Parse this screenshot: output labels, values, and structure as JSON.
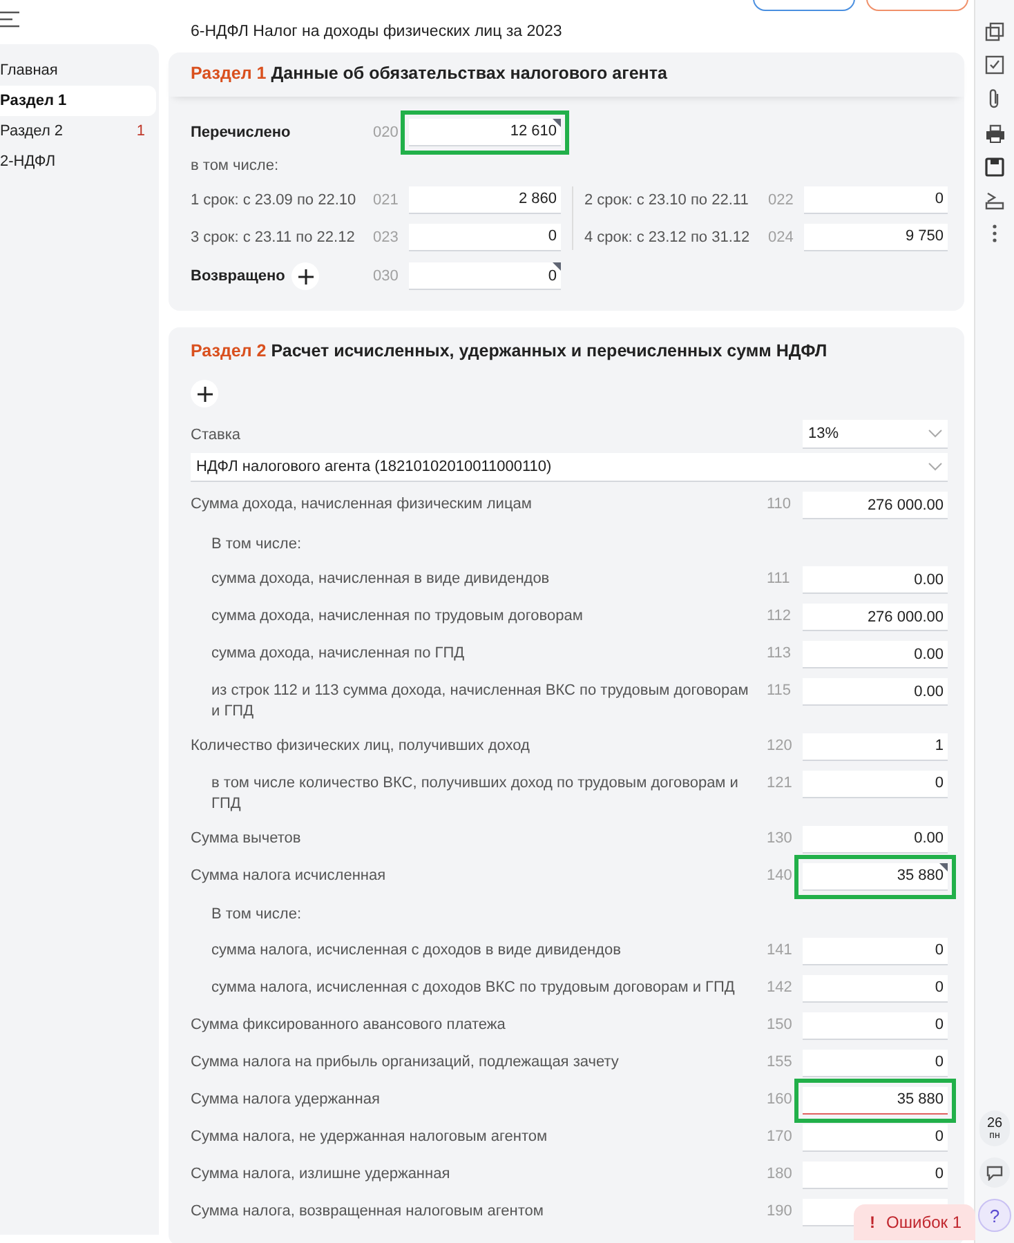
{
  "header": {
    "title": "6-НДФЛ Налог на доходы физических лиц за 2023"
  },
  "sidebar": {
    "items": [
      {
        "label": "Главная",
        "selected": false
      },
      {
        "label": "Раздел 1",
        "selected": true
      },
      {
        "label": "Раздел 2",
        "selected": false,
        "badge": "1"
      },
      {
        "label": "2-НДФЛ",
        "selected": false
      }
    ]
  },
  "section1": {
    "number": "Раздел 1",
    "title": "Данные об обязательствах налогового агента",
    "total": {
      "label": "Перечислено",
      "code": "020",
      "value": "12 610",
      "marked": true,
      "highlighted": true,
      "error": false
    },
    "subtitle": "в том числе:",
    "terms": [
      {
        "label": "1 срок: с 23.09 по 22.10",
        "code": "021",
        "value": "2 860"
      },
      {
        "label": "2 срок: с 23.10 по 22.11",
        "code": "022",
        "value": "0"
      },
      {
        "label": "3 срок: с 23.11 по 22.12",
        "code": "023",
        "value": "0"
      },
      {
        "label": "4 срок: с 23.12 по 31.12",
        "code": "024",
        "value": "9 750"
      }
    ],
    "returned": {
      "label": "Возвращено",
      "code": "030",
      "value": "0",
      "marked": true,
      "highlighted": false,
      "error": false
    }
  },
  "section2": {
    "number": "Раздел 2",
    "title": "Расчет исчисленных, удержанных и перечисленных сумм НДФЛ",
    "rate": {
      "label": "Ставка",
      "value": "13%"
    },
    "kbk": "НДФЛ налогового агента (18210102010011000110)",
    "rows": [
      {
        "kind": "line",
        "label": "Сумма дохода, начисленная физическим лицам",
        "code": "110",
        "value": "276 000.00",
        "marked": false,
        "highlighted": false,
        "error": false
      },
      {
        "kind": "note",
        "label": "В том числе:"
      },
      {
        "kind": "subline",
        "label": "сумма дохода, начисленная в виде дивидендов",
        "code": "111",
        "value": "0.00",
        "marked": false,
        "highlighted": false,
        "error": false
      },
      {
        "kind": "subline",
        "label": "сумма дохода, начисленная по трудовым договорам",
        "code": "112",
        "value": "276 000.00",
        "marked": false,
        "highlighted": false,
        "error": false
      },
      {
        "kind": "subline",
        "label": "сумма дохода, начисленная по ГПД",
        "code": "113",
        "value": "0.00",
        "marked": false,
        "highlighted": false,
        "error": false
      },
      {
        "kind": "subline",
        "label": "из строк 112 и 113 сумма дохода, начисленная ВКС по трудовым договорам и ГПД",
        "code": "115",
        "value": "0.00",
        "marked": false,
        "highlighted": false,
        "error": false
      },
      {
        "kind": "line",
        "label": "Количество физических лиц, получивших доход",
        "code": "120",
        "value": "1",
        "marked": false,
        "highlighted": false,
        "error": false
      },
      {
        "kind": "subline",
        "label": "в том числе количество ВКС, получивших доход по трудовым договорам и ГПД",
        "code": "121",
        "value": "0",
        "marked": false,
        "highlighted": false,
        "error": false
      },
      {
        "kind": "line",
        "label": "Сумма вычетов",
        "code": "130",
        "value": "0.00",
        "marked": false,
        "highlighted": false,
        "error": false
      },
      {
        "kind": "line",
        "label": "Сумма налога исчисленная",
        "code": "140",
        "value": "35 880",
        "marked": true,
        "highlighted": true,
        "error": false
      },
      {
        "kind": "note",
        "label": "В том числе:"
      },
      {
        "kind": "subline",
        "label": "сумма налога, исчисленная с доходов в виде дивидендов",
        "code": "141",
        "value": "0",
        "marked": false,
        "highlighted": false,
        "error": false
      },
      {
        "kind": "subline",
        "label": "сумма налога, исчисленная с доходов ВКС по трудовым договорам и ГПД",
        "code": "142",
        "value": "0",
        "marked": false,
        "highlighted": false,
        "error": false
      },
      {
        "kind": "line",
        "label": "Сумма фиксированного авансового платежа",
        "code": "150",
        "value": "0",
        "marked": false,
        "highlighted": false,
        "error": false
      },
      {
        "kind": "line",
        "label": "Сумма налога на прибыль организаций, подлежащая зачету",
        "code": "155",
        "value": "0",
        "marked": false,
        "highlighted": false,
        "error": false
      },
      {
        "kind": "line",
        "label": "Сумма налога удержанная",
        "code": "160",
        "value": "35 880",
        "marked": false,
        "highlighted": true,
        "error": true
      },
      {
        "kind": "line",
        "label": "Сумма налога, не удержанная налоговым агентом",
        "code": "170",
        "value": "0",
        "marked": false,
        "highlighted": false,
        "error": false
      },
      {
        "kind": "line",
        "label": "Сумма налога, излишне удержанная",
        "code": "180",
        "value": "0",
        "marked": false,
        "highlighted": false,
        "error": false
      },
      {
        "kind": "line",
        "label": "Сумма налога, возвращенная налоговым агентом",
        "code": "190",
        "value": "",
        "marked": false,
        "highlighted": false,
        "error": false
      }
    ]
  },
  "errors": {
    "icon": "!",
    "label": "Ошибок 1"
  },
  "rail": {
    "calendar": {
      "day": "26",
      "weekday": "пн"
    },
    "help": "?"
  }
}
